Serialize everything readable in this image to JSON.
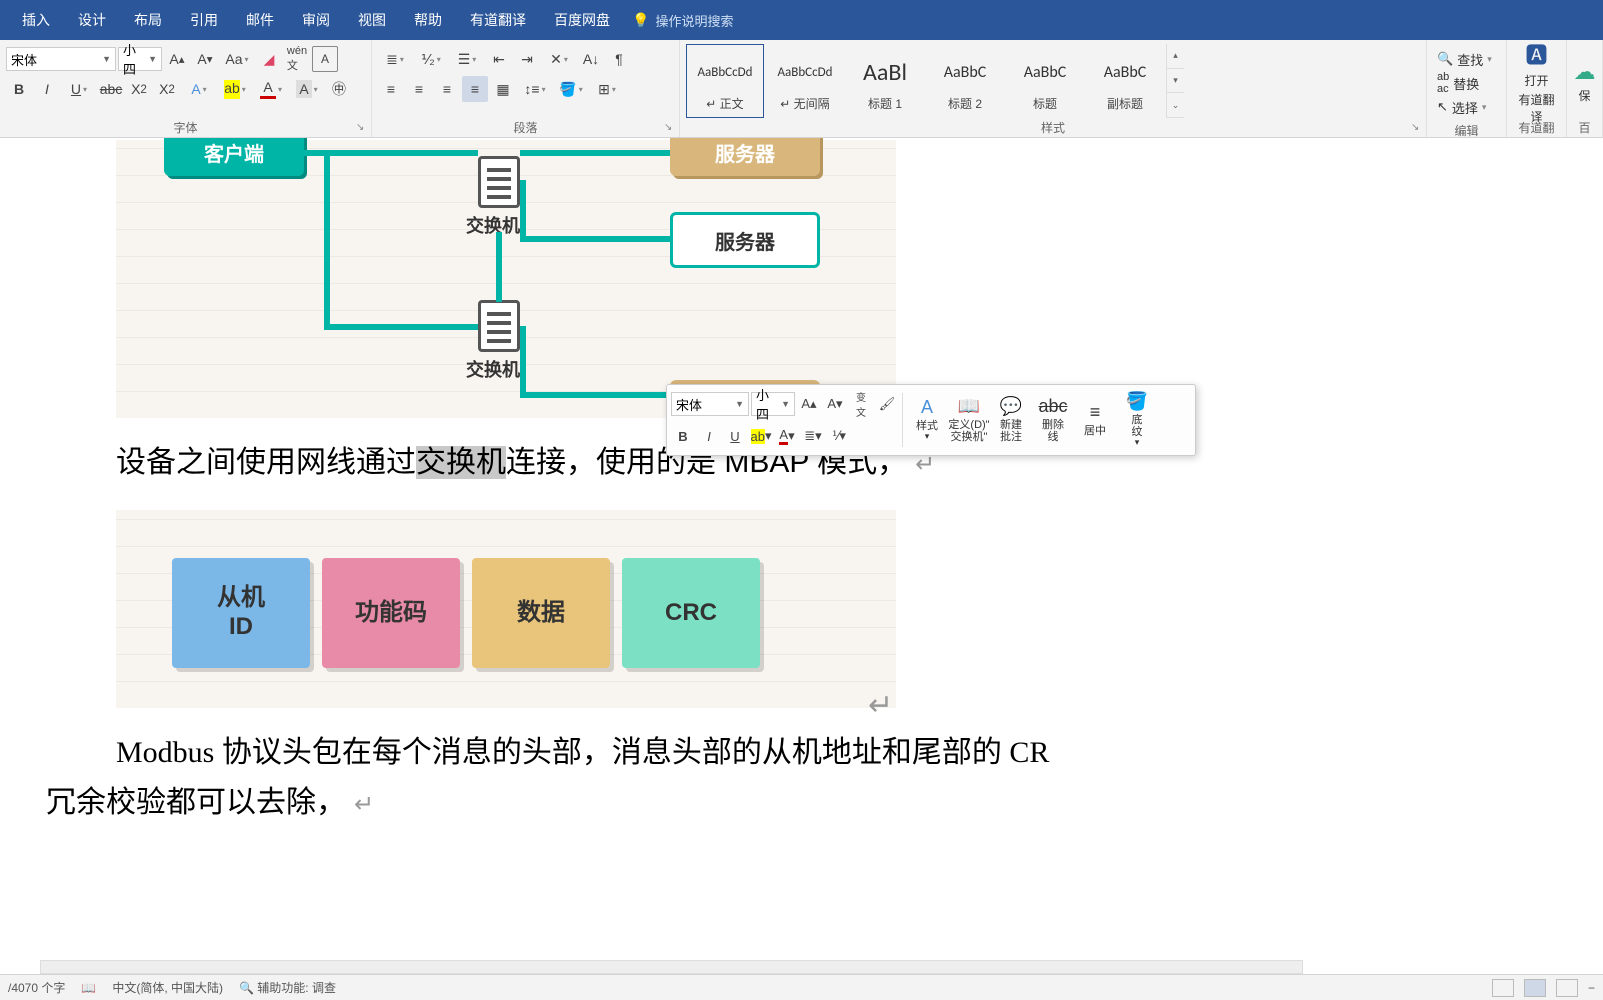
{
  "menu": {
    "items": [
      "插入",
      "设计",
      "布局",
      "引用",
      "邮件",
      "审阅",
      "视图",
      "帮助",
      "有道翻译",
      "百度网盘"
    ],
    "search_hint": "操作说明搜索"
  },
  "ribbon": {
    "font": {
      "label": "字体",
      "name": "宋体",
      "size": "小四"
    },
    "paragraph": {
      "label": "段落"
    },
    "styles": {
      "label": "样式",
      "items": [
        {
          "preview": "AaBbCcDd",
          "label": "↵ 正文",
          "cls": "small"
        },
        {
          "preview": "AaBbCcDd",
          "label": "↵ 无间隔",
          "cls": "small"
        },
        {
          "preview": "AaBl",
          "label": "标题 1",
          "cls": "big"
        },
        {
          "preview": "AaBbC",
          "label": "标题 2",
          "cls": "med"
        },
        {
          "preview": "AaBbC",
          "label": "标题",
          "cls": "med"
        },
        {
          "preview": "AaBbC",
          "label": "副标题",
          "cls": "med"
        }
      ]
    },
    "edit": {
      "label": "编辑",
      "find": "查找",
      "replace": "替换",
      "select": "选择"
    },
    "youdao": {
      "label": "有道翻译",
      "btn1": "打开",
      "btn2": "有道翻译"
    },
    "baidu": {
      "label": "百度",
      "btn": "保"
    }
  },
  "doc": {
    "diagram1": {
      "client": "客户端",
      "server_top": "服务器",
      "server_mid": "服务器",
      "switch": "交换机"
    },
    "line1_before": "设备之间使用网线通过",
    "line1_sel": "交换机",
    "line1_after": "连接，使用的是 MBAP 模式，",
    "diagram2": {
      "b1": "从机\nID",
      "b2": "功能码",
      "b3": "数据",
      "b4": "CRC"
    },
    "line2": "Modbus 协议头包在每个消息的头部，消息头部的从机地址和尾部的 CR",
    "line3": "冗余校验都可以去除，"
  },
  "mini": {
    "font": "宋体",
    "size": "小四",
    "styles": "样式",
    "define": "定义(D)\"\n交换机\"",
    "comment": "新建\n批注",
    "strike": "删除\n线",
    "center": "居中",
    "shading": "底\n纹"
  },
  "status": {
    "words": "/4070 个字",
    "lang": "中文(简体, 中国大陆)",
    "a11y": "辅助功能: 调查"
  }
}
